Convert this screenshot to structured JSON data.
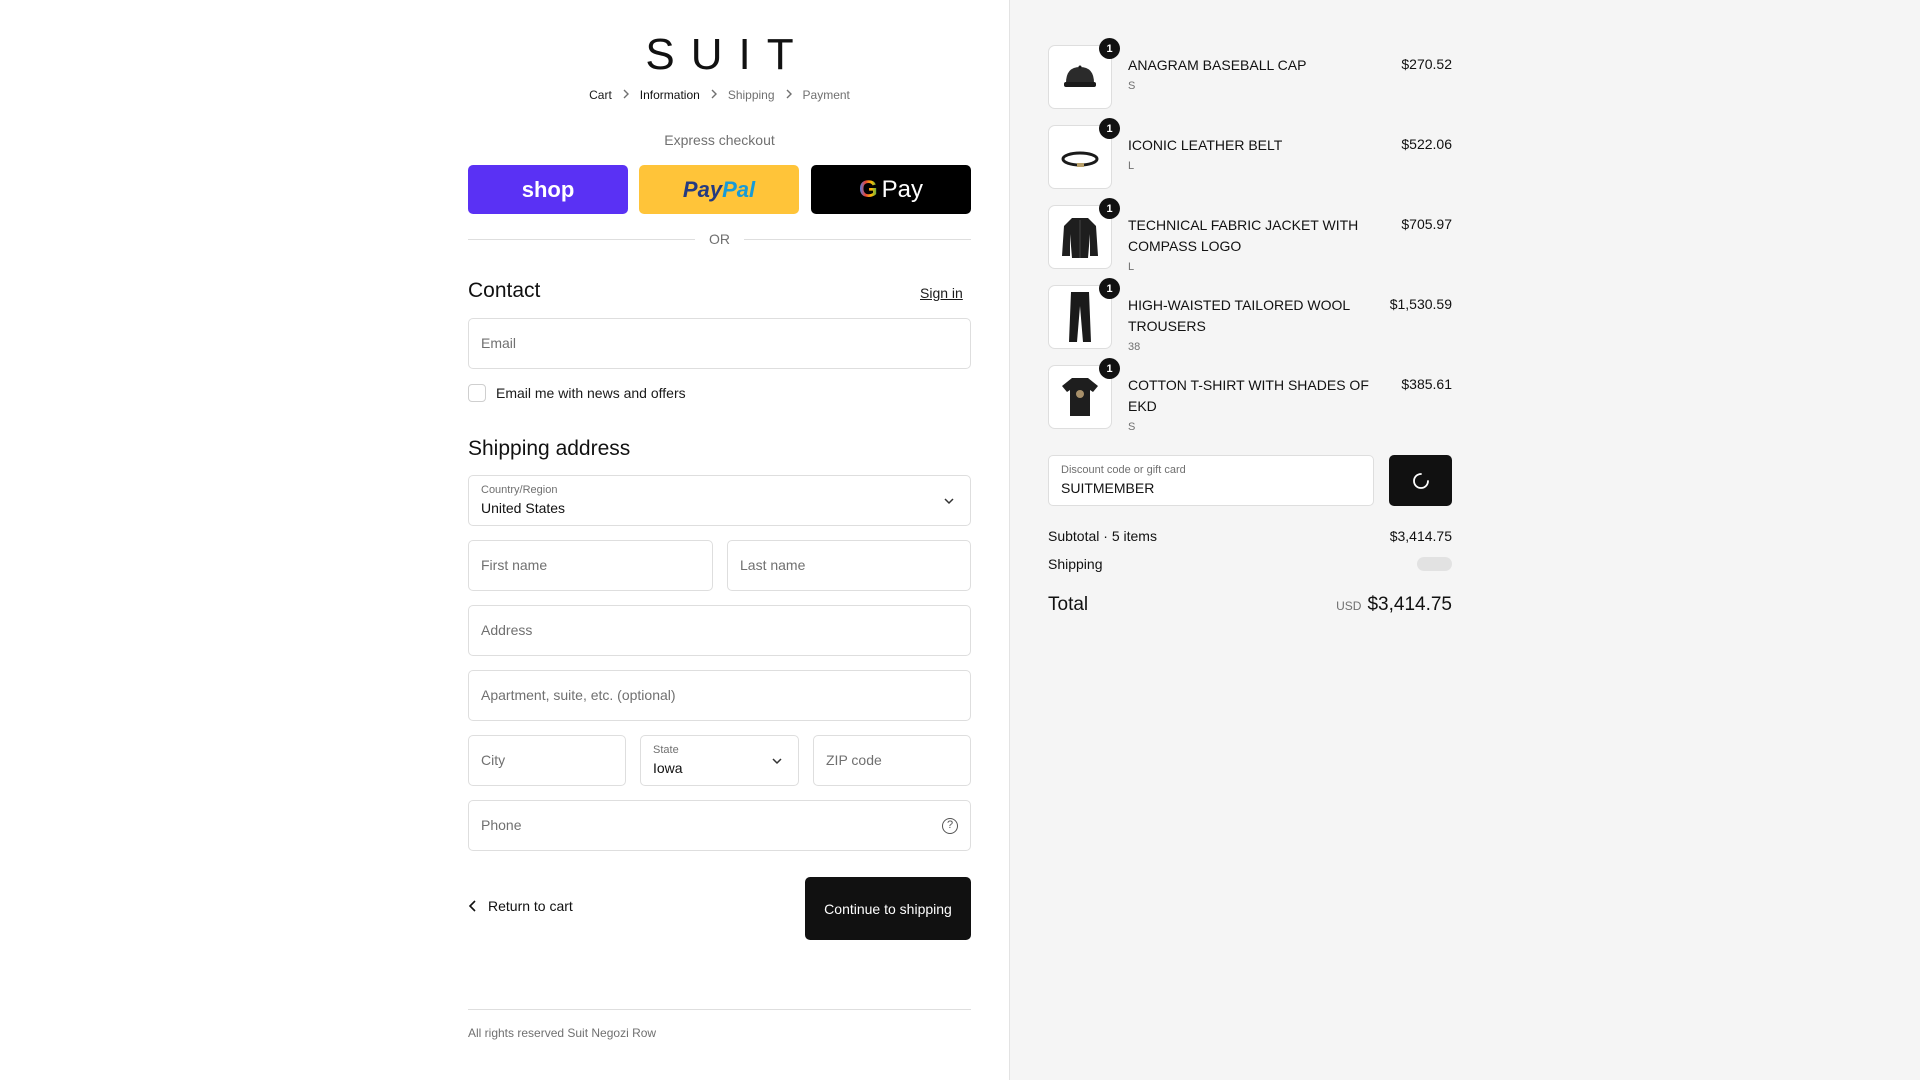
{
  "brand": {
    "logo": "SUIT"
  },
  "breadcrumbs": [
    {
      "label": "Cart"
    },
    {
      "label": "Information"
    },
    {
      "label": "Shipping"
    },
    {
      "label": "Payment"
    }
  ],
  "express": {
    "label": "Express checkout",
    "shop_label": "shop",
    "paypal_a": "Pay",
    "paypal_b": "Pal",
    "gpay_g": "G",
    "gpay_label": "Pay",
    "or_label": "OR"
  },
  "contact": {
    "title": "Contact",
    "signin": "Sign in",
    "email_placeholder": "Email",
    "newsletter_label": "Email me with news and offers"
  },
  "shipping_address": {
    "title": "Shipping address",
    "country_label": "Country/Region",
    "country_value": "United States",
    "first_name_placeholder": "First name",
    "last_name_placeholder": "Last name",
    "address_placeholder": "Address",
    "apartment_placeholder": "Apartment, suite, etc. (optional)",
    "city_placeholder": "City",
    "state_label": "State",
    "state_value": "Iowa",
    "zip_placeholder": "ZIP code",
    "phone_placeholder": "Phone",
    "help_glyph": "?"
  },
  "actions": {
    "return_label": "Return to cart",
    "continue_label": "Continue to shipping"
  },
  "footer": {
    "text": "All rights reserved Suit Negozi Row"
  },
  "order": {
    "items": [
      {
        "name": "ANAGRAM BASEBALL CAP",
        "variant": "S",
        "price": "$270.52",
        "qty": "1",
        "icon": "cap-icon"
      },
      {
        "name": "ICONIC LEATHER BELT",
        "variant": "L",
        "price": "$522.06",
        "qty": "1",
        "icon": "belt-icon"
      },
      {
        "name": "TECHNICAL FABRIC JACKET WITH COMPASS LOGO",
        "variant": "L",
        "price": "$705.97",
        "qty": "1",
        "icon": "jacket-icon"
      },
      {
        "name": "HIGH-WAISTED TAILORED WOOL TROUSERS",
        "variant": "38",
        "price": "$1,530.59",
        "qty": "1",
        "icon": "trousers-icon"
      },
      {
        "name": "COTTON T-SHIRT WITH SHADES OF EKD",
        "variant": "S",
        "price": "$385.61",
        "qty": "1",
        "icon": "tshirt-icon"
      }
    ],
    "discount_label": "Discount code or gift card",
    "discount_value": "SUITMEMBER",
    "subtotal_label": "Subtotal · 5 items",
    "subtotal_value": "$3,414.75",
    "shipping_label": "Shipping",
    "total_label": "Total",
    "currency": "USD",
    "total_value": "$3,414.75"
  },
  "colors": {
    "shop": "#5a31f4",
    "paypal": "#ffc439",
    "gpay": "#000000",
    "primary_button": "#111111",
    "sidebar_bg": "#f5f5f5"
  }
}
